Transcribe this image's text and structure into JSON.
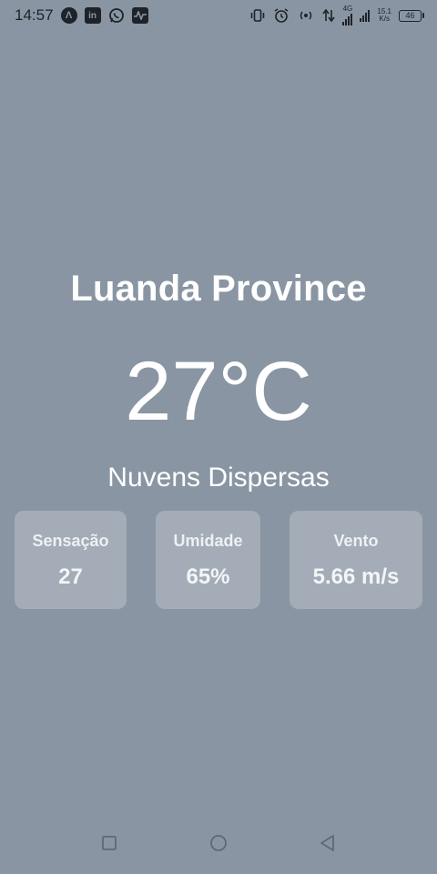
{
  "status_bar": {
    "time": "14:57",
    "net_type": "4G",
    "speed_value": "15.1",
    "speed_unit": "K/s",
    "battery": "46",
    "left_icons": [
      "app-a-icon",
      "linkedin-icon",
      "whatsapp-icon",
      "activity-icon"
    ],
    "right_icons": [
      "vibrate-icon",
      "alarm-icon",
      "hotspot-icon",
      "data-arrows-icon",
      "signal-icon",
      "signal-icon",
      "battery-icon"
    ]
  },
  "weather": {
    "city": "Luanda Province",
    "temperature": "27°C",
    "description": "Nuvens Dispersas"
  },
  "stats": [
    {
      "label": "Sensação",
      "value": "27"
    },
    {
      "label": "Umidade",
      "value": "65%"
    },
    {
      "label": "Vento",
      "value": "5.66 m/s"
    }
  ],
  "nav": {
    "buttons": [
      "recents-square-icon",
      "home-circle-icon",
      "back-triangle-icon"
    ]
  },
  "colors": {
    "background": "#8a95a3",
    "card": "rgba(255,255,255,0.22)",
    "text": "#ffffff",
    "status_text": "#1f2329"
  }
}
